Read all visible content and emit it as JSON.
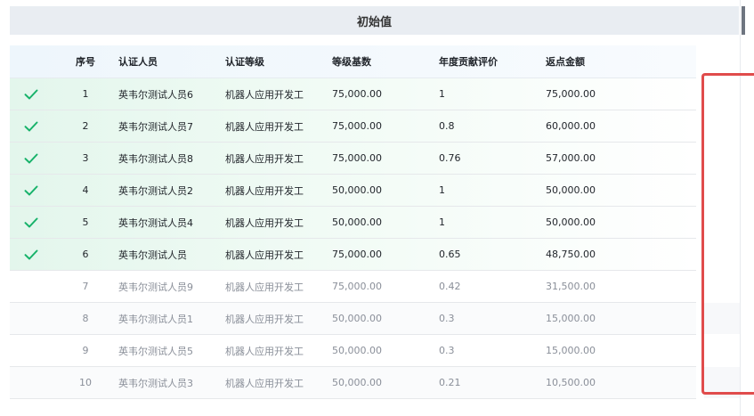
{
  "title": "初始值",
  "columns": [
    "",
    "序号",
    "认证人员",
    "认证等级",
    "等级基数",
    "年度贡献评价",
    "返点金额"
  ],
  "rows": [
    {
      "checked": true,
      "idx": "1",
      "name": "英韦尔测试人员6",
      "level": "机器人应用开发工",
      "base": "75,000.00",
      "eval": "1",
      "amount": "75,000.00"
    },
    {
      "checked": true,
      "idx": "2",
      "name": "英韦尔测试人员7",
      "level": "机器人应用开发工",
      "base": "75,000.00",
      "eval": "0.8",
      "amount": "60,000.00"
    },
    {
      "checked": true,
      "idx": "3",
      "name": "英韦尔测试人员8",
      "level": "机器人应用开发工",
      "base": "75,000.00",
      "eval": "0.76",
      "amount": "57,000.00"
    },
    {
      "checked": true,
      "idx": "4",
      "name": "英韦尔测试人员2",
      "level": "机器人应用开发工",
      "base": "50,000.00",
      "eval": "1",
      "amount": "50,000.00"
    },
    {
      "checked": true,
      "idx": "5",
      "name": "英韦尔测试人员4",
      "level": "机器人应用开发工",
      "base": "50,000.00",
      "eval": "1",
      "amount": "50,000.00"
    },
    {
      "checked": true,
      "idx": "6",
      "name": "英韦尔测试人员",
      "level": "机器人应用开发工",
      "base": "75,000.00",
      "eval": "0.65",
      "amount": "48,750.00"
    },
    {
      "checked": false,
      "idx": "7",
      "name": "英韦尔测试人员9",
      "level": "机器人应用开发工",
      "base": "75,000.00",
      "eval": "0.42",
      "amount": "31,500.00"
    },
    {
      "checked": false,
      "idx": "8",
      "name": "英韦尔测试人员1",
      "level": "机器人应用开发工",
      "base": "50,000.00",
      "eval": "0.3",
      "amount": "15,000.00"
    },
    {
      "checked": false,
      "idx": "9",
      "name": "英韦尔测试人员5",
      "level": "机器人应用开发工",
      "base": "50,000.00",
      "eval": "0.3",
      "amount": "15,000.00"
    },
    {
      "checked": false,
      "idx": "10",
      "name": "英韦尔测试人员3",
      "level": "机器人应用开发工",
      "base": "50,000.00",
      "eval": "0.21",
      "amount": "10,500.00"
    }
  ],
  "colors": {
    "check": "#17b26a",
    "highlight": "#e04c4c",
    "header_bg": "#e9edf2"
  }
}
